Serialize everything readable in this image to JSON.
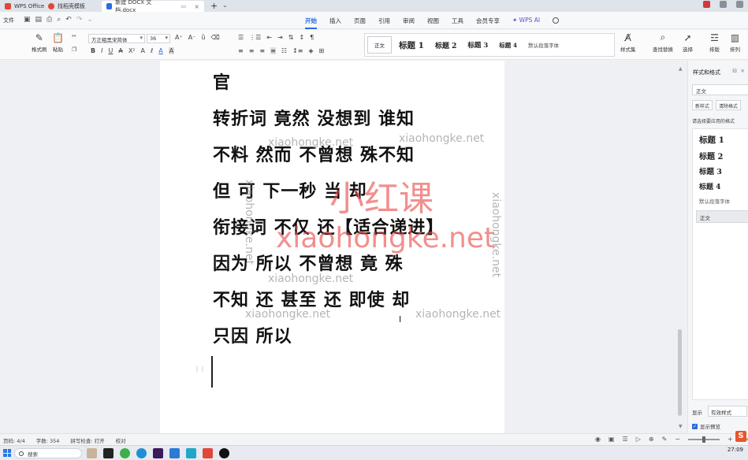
{
  "tabs": [
    {
      "label": "WPS Office",
      "color": "#e0473a"
    },
    {
      "label": "找稻壳模板",
      "color": "#e0473a"
    },
    {
      "label": "新建 DOCX 文档.docx",
      "color": "#2a6ae5",
      "active": true
    }
  ],
  "menubar": {
    "file": "文件",
    "menus": [
      "开始",
      "插入",
      "页面",
      "引用",
      "审阅",
      "视图",
      "工具",
      "会员专享"
    ],
    "active_menu": "开始",
    "ai": "WPS AI"
  },
  "ribbon": {
    "format_painter": "格式刷",
    "paste": "粘贴",
    "font_name": "方正粗黑宋简体",
    "font_size": "36",
    "styles": {
      "normal": "正文",
      "h1": "标题 1",
      "h2": "标题 2",
      "h3": "标题 3",
      "h4": "标题 4",
      "default_font": "默认段落字体"
    },
    "style_set": "样式集",
    "find_replace": "查找替换",
    "select": "选择",
    "layout": "排版",
    "arrange": "排列"
  },
  "document": {
    "lines": [
      "官",
      "转折词 竟然 没想到 谁知",
      "不料 然而 不曾想 殊不知",
      "但 可 下一秒 当 却",
      "衔接词 不仅 还【适合递进】",
      "因为 所以 不曾想 竟 殊",
      "不知 还 甚至 还 即使 却",
      "只因 所以"
    ]
  },
  "watermark": {
    "brand_cn": "小红课",
    "brand_url": "xiaohongke.net",
    "url": "xiaohongke.net"
  },
  "sidepanel": {
    "title": "样式和格式",
    "current": "正文",
    "new_style": "新样式",
    "clear_format": "清除格式",
    "prompt": "请选择要应用的格式",
    "styles": [
      "标题 1",
      "标题 2",
      "标题 3",
      "标题 4"
    ],
    "default_font": "默认段落字体",
    "selected": "正文",
    "show_label": "显示",
    "show_value": "有效样式",
    "preview_label": "显示预览"
  },
  "statusbar": {
    "page": "页码: 4/4",
    "words": "字数: 354",
    "spell": "拼写检查: 打开",
    "proof": "校对",
    "zoom": "100%"
  },
  "taskbar": {
    "search": "搜索",
    "time": "27:09"
  }
}
